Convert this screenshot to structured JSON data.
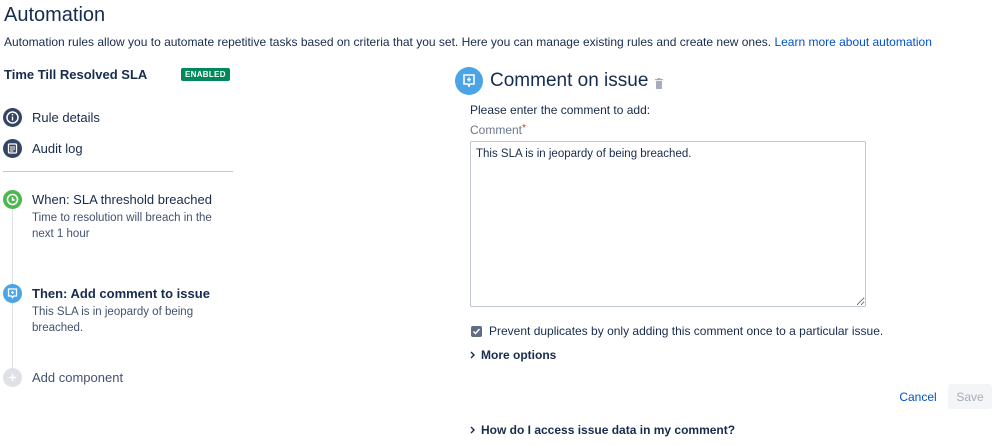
{
  "page": {
    "title": "Automation",
    "description": "Automation rules allow you to automate repetitive tasks based on criteria that you set. Here you can manage existing rules and create new ones. ",
    "learn_more_link": "Learn more about automation"
  },
  "rule": {
    "name": "Time Till Resolved SLA",
    "status": "ENABLED"
  },
  "sidebar": {
    "items": [
      {
        "label": "Rule details",
        "icon": "info-icon"
      },
      {
        "label": "Audit log",
        "icon": "list-icon"
      }
    ],
    "steps": [
      {
        "title": "When: SLA threshold breached",
        "description": "Time to resolution will breach in the next 1 hour",
        "icon": "clock-icon",
        "color": "#4fb74f"
      },
      {
        "title": "Then: Add comment to issue",
        "description": "This SLA is in jeopardy of being breached.",
        "icon": "comment-icon",
        "color": "#4aa4e6"
      }
    ],
    "add_component": "Add component"
  },
  "panel": {
    "title": "Comment on issue",
    "prompt": "Please enter the comment to add:",
    "comment_label": "Comment",
    "required_mark": "*",
    "comment_value": "This SLA is in jeopardy of being breached.",
    "prevent_duplicates_label": "Prevent duplicates by only adding this comment once to a particular issue.",
    "prevent_duplicates_checked": true,
    "more_options": "More options",
    "help_expander": "How do I access issue data in my comment?"
  },
  "actions": {
    "cancel": "Cancel",
    "save": "Save"
  },
  "colors": {
    "accent": "#0052cc",
    "enabled_badge": "#00875a",
    "trigger_step": "#4fb74f",
    "action_step": "#4aa4e6"
  }
}
